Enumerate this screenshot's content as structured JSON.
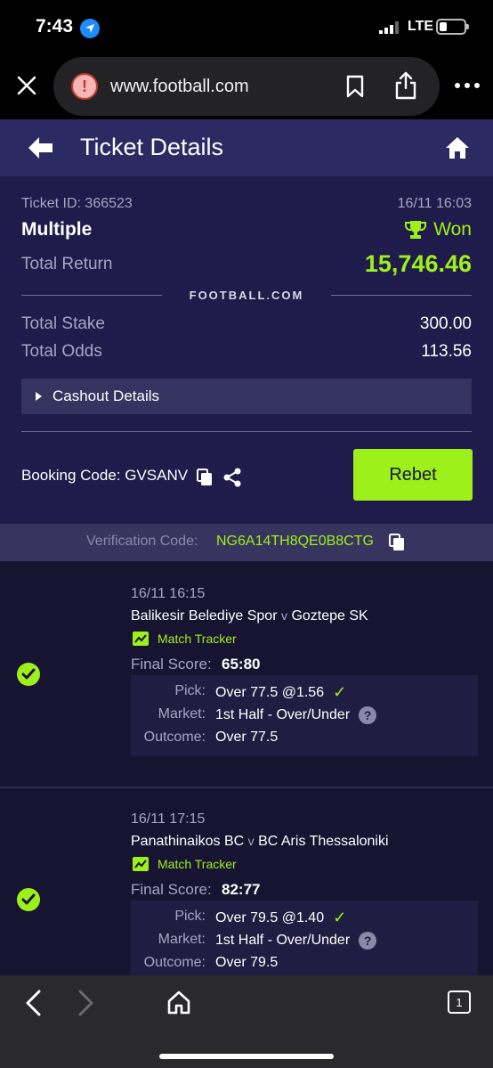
{
  "status_bar": {
    "time": "7:43",
    "network": "LTE"
  },
  "browser": {
    "url": "www.football.com",
    "warning_glyph": "!",
    "tab_count": "1"
  },
  "header": {
    "title": "Ticket Details"
  },
  "ticket": {
    "id_label": "Ticket ID: 366523",
    "datetime": "16/11 16:03",
    "type": "Multiple",
    "status": "Won",
    "total_return_label": "Total Return",
    "total_return_value": "15,746.46",
    "brand_main": "FOOTBALL",
    "brand_dot": ".",
    "brand_tld": "COM",
    "total_stake_label": "Total Stake",
    "total_stake_value": "300.00",
    "total_odds_label": "Total Odds",
    "total_odds_value": "113.56",
    "cashout_label": "Cashout Details",
    "booking_label": "Booking Code: GVSANV",
    "rebet_label": "Rebet"
  },
  "verification": {
    "label": "Verification Code:",
    "code": "NG6A14TH8QE0B8CTG"
  },
  "selections": [
    {
      "date": "16/11 16:15",
      "home": "Balikesir Belediye Spor",
      "vs": "v",
      "away": "Goztepe SK",
      "tracker": "Match Tracker",
      "score_label": "Final Score:",
      "score": "65:80",
      "pick_label": "Pick:",
      "pick": "Over 77.5 @1.56",
      "market_label": "Market:",
      "market": "1st Half - Over/Under",
      "outcome_label": "Outcome:",
      "outcome": "Over 77.5"
    },
    {
      "date": "16/11 17:15",
      "home": "Panathinaikos BC",
      "vs": "v",
      "away": "BC Aris Thessaloniki",
      "tracker": "Match Tracker",
      "score_label": "Final Score:",
      "score": "82:77",
      "pick_label": "Pick:",
      "pick": "Over 79.5 @1.40",
      "market_label": "Market:",
      "market": "1st Half - Over/Under",
      "outcome_label": "Outcome:",
      "outcome": "Over 79.5"
    }
  ],
  "colors": {
    "accent": "#9ef01a",
    "header": "#2b2a62",
    "panel": "#1f1b4a",
    "list_bg": "#171432"
  },
  "icons": [
    "location-arrow-icon",
    "close-icon",
    "warning-icon",
    "bookmark-icon",
    "share-icon",
    "more-icon",
    "back-arrow-icon",
    "home-icon",
    "trophy-icon",
    "copy-icon",
    "share-nodes-icon",
    "check-circle-icon",
    "chart-icon",
    "help-icon",
    "chevron-left-icon",
    "chevron-right-icon",
    "tabs-icon"
  ]
}
